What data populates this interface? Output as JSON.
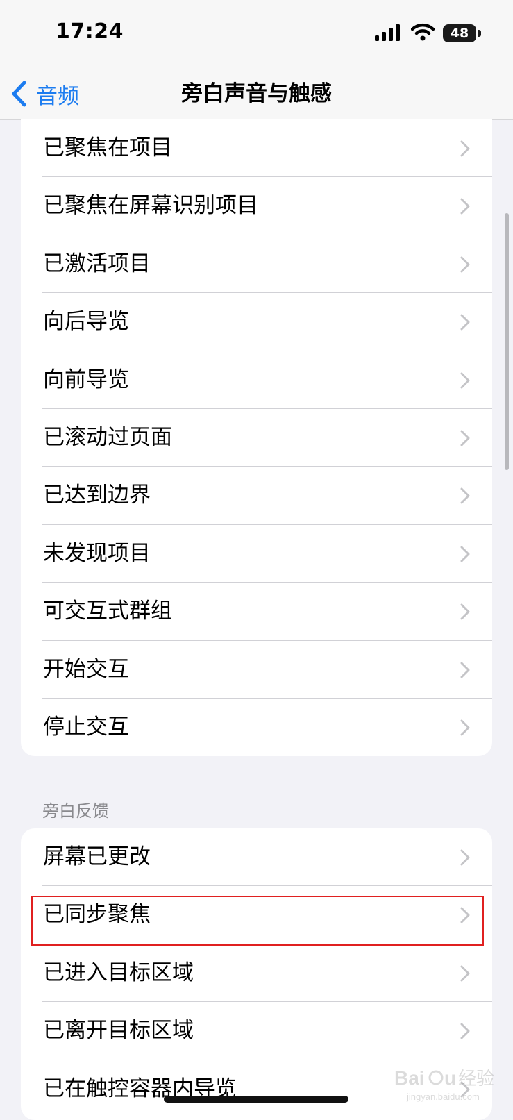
{
  "status_bar": {
    "time": "17:24",
    "battery": "48",
    "icons": [
      "signal-icon",
      "wifi-icon",
      "battery-icon"
    ]
  },
  "nav": {
    "back_label": "音频",
    "title": "旁白声音与触感"
  },
  "group1": {
    "items": [
      {
        "label": "已聚焦在项目"
      },
      {
        "label": "已聚焦在屏幕识别项目"
      },
      {
        "label": "已激活项目"
      },
      {
        "label": "向后导览"
      },
      {
        "label": "向前导览"
      },
      {
        "label": "已滚动过页面"
      },
      {
        "label": "已达到边界"
      },
      {
        "label": "未发现项目"
      },
      {
        "label": "可交互式群组"
      },
      {
        "label": "开始交互"
      },
      {
        "label": "停止交互"
      }
    ]
  },
  "group2": {
    "header": "旁白反馈",
    "items": [
      {
        "label": "屏幕已更改"
      },
      {
        "label": "已同步聚焦"
      },
      {
        "label": "已进入目标区域"
      },
      {
        "label": "已离开目标区域"
      },
      {
        "label": "已在触控容器内导览"
      }
    ]
  },
  "watermark": {
    "text": "Baidu经验",
    "sub": "jingyan.baidu.com"
  },
  "colors": {
    "accent": "#1c7cf0",
    "background": "#f2f2f7",
    "highlight": "#e02020"
  }
}
